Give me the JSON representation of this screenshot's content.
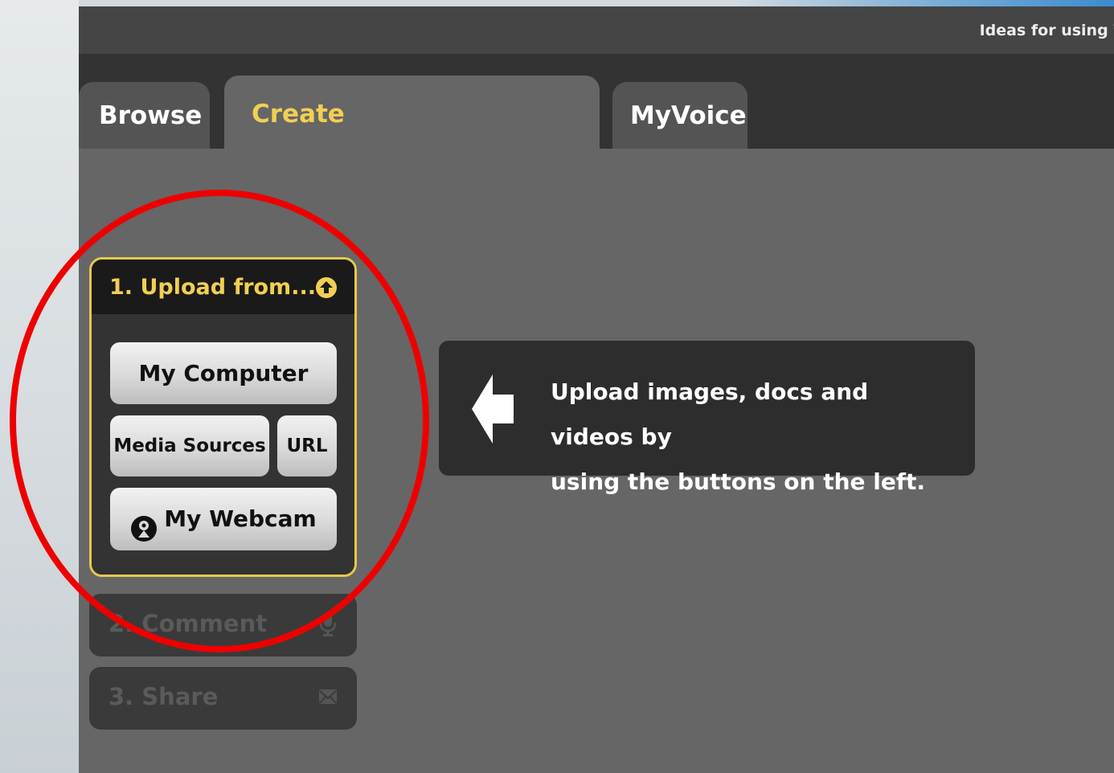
{
  "header": {
    "ideas_link": "Ideas for using V"
  },
  "tabs": [
    {
      "label": "Browse",
      "active": false
    },
    {
      "label": "Create",
      "active": true
    },
    {
      "label": "MyVoice",
      "active": false
    }
  ],
  "upload_panel": {
    "title": "1. Upload from...",
    "icon": "up-arrow-icon",
    "buttons": {
      "my_computer": "My Computer",
      "media_sources": "Media Sources",
      "url": "URL",
      "my_webcam": "My Webcam"
    }
  },
  "steps": {
    "comment": {
      "label": "2. Comment",
      "icon": "microphone-icon"
    },
    "share": {
      "label": "3. Share",
      "icon": "envelope-icon"
    }
  },
  "hint": {
    "line1": "Upload images, docs and videos by",
    "line2": "using the buttons on the left."
  },
  "colors": {
    "accent": "#f1cf53",
    "panel_border": "#e7c94b",
    "highlight": "#ee0000",
    "background": "#666666"
  }
}
